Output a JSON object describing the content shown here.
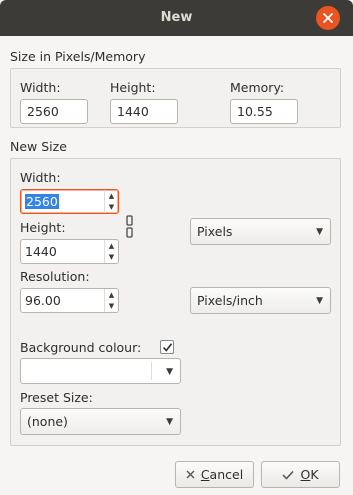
{
  "window": {
    "title": "New",
    "close_icon": "close-icon"
  },
  "current_size": {
    "section_label": "Size in Pixels/Memory",
    "width_label": "Width:",
    "width_value": "2560",
    "height_label": "Height:",
    "height_value": "1440",
    "memory_label": "Memory:",
    "memory_value": "10.55"
  },
  "new_size": {
    "section_label": "New Size",
    "width_label": "Width:",
    "width_value": "2560",
    "height_label": "Height:",
    "height_value": "1440",
    "unit": "Pixels",
    "resolution_label": "Resolution:",
    "resolution_value": "96.00",
    "resolution_unit": "Pixels/inch",
    "background_label": "Background colour:",
    "background_checked": true,
    "background_color": "#ffffff",
    "preset_label": "Preset Size:",
    "preset_value": "(none)"
  },
  "buttons": {
    "cancel_first": "C",
    "cancel_rest": "ancel",
    "ok_first": "O",
    "ok_rest": "K"
  },
  "colors": {
    "accent": "#e95420",
    "selection": "#3584e4",
    "titlebar": "#3c3b37"
  }
}
